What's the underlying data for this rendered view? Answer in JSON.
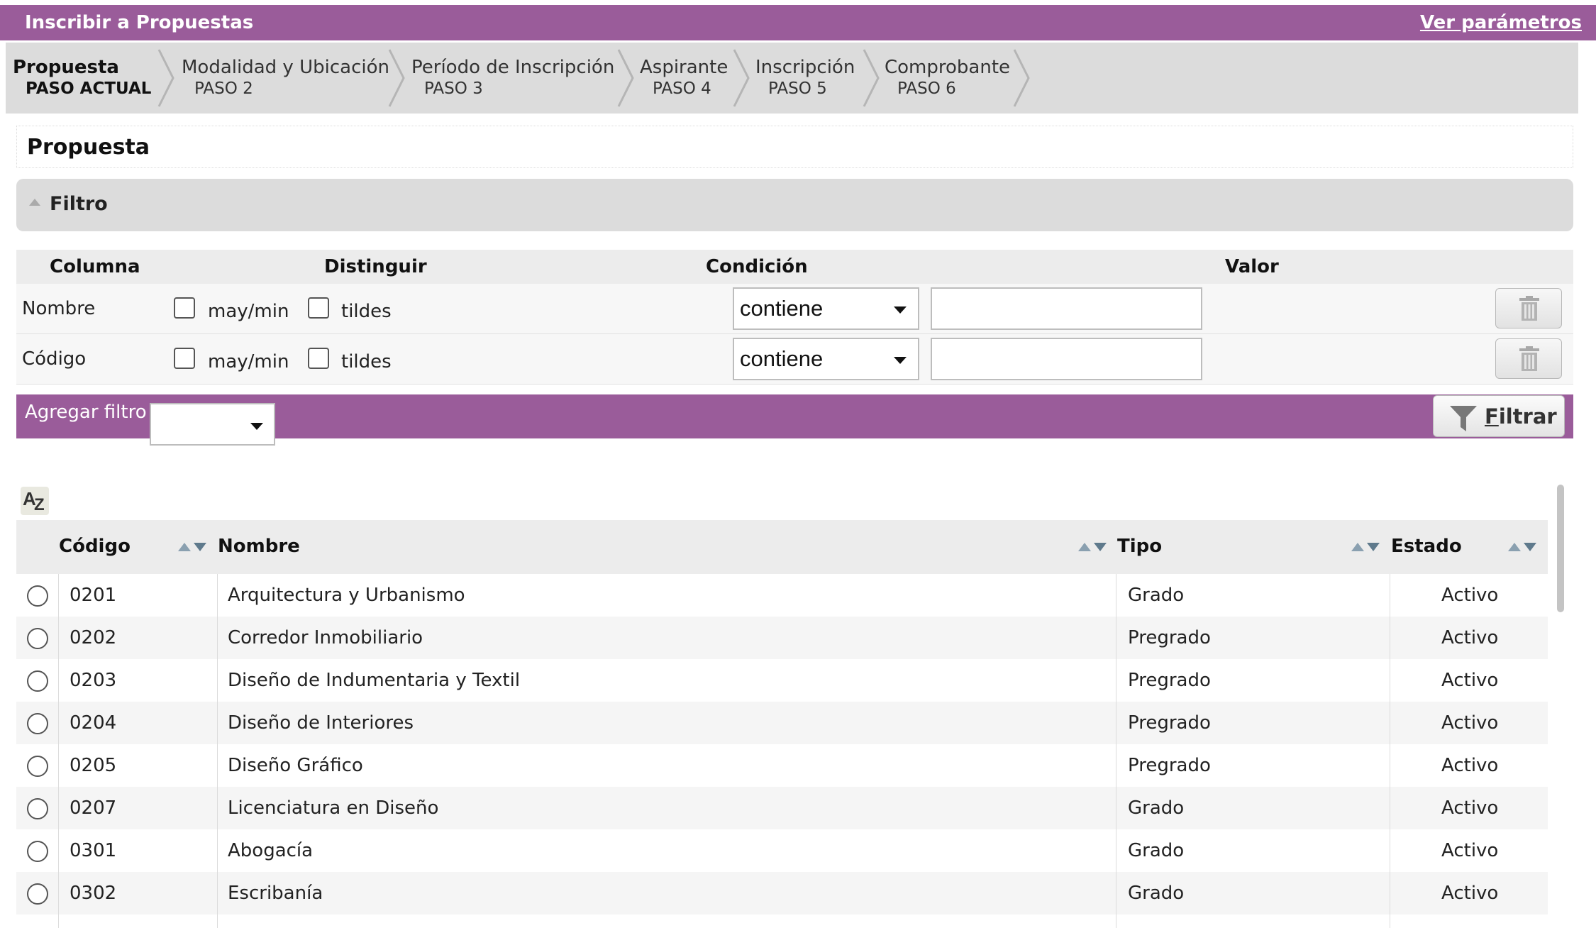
{
  "titlebar": {
    "title": "Inscribir a Propuestas",
    "params_link": "Ver parámetros"
  },
  "steps": [
    {
      "label": "Propuesta",
      "sub": "PASO ACTUAL",
      "current": true
    },
    {
      "label": "Modalidad y Ubicación",
      "sub": "PASO 2"
    },
    {
      "label": "Período de Inscripción",
      "sub": "PASO 3"
    },
    {
      "label": "Aspirante",
      "sub": "PASO 4"
    },
    {
      "label": "Inscripción",
      "sub": "PASO 5"
    },
    {
      "label": "Comprobante",
      "sub": "PASO 6"
    }
  ],
  "section": {
    "title": "Propuesta"
  },
  "filtro": {
    "label": "Filtro",
    "headers": {
      "columna": "Columna",
      "distinguir": "Distinguir",
      "condicion": "Condición",
      "valor": "Valor"
    },
    "rows": [
      {
        "column": "Nombre",
        "case_label": "may/min",
        "accent_label": "tildes",
        "condition": "contiene",
        "value": ""
      },
      {
        "column": "Código",
        "case_label": "may/min",
        "accent_label": "tildes",
        "condition": "contiene",
        "value": ""
      }
    ],
    "add_filter_label": "Agregar filtro",
    "add_filter_value": "",
    "filter_button_first": "F",
    "filter_button_rest": "iltrar"
  },
  "results": {
    "headers": {
      "codigo": "Código",
      "nombre": "Nombre",
      "tipo": "Tipo",
      "estado": "Estado"
    },
    "rows": [
      {
        "codigo": "0201",
        "nombre": "Arquitectura y Urbanismo",
        "tipo": "Grado",
        "estado": "Activo"
      },
      {
        "codigo": "0202",
        "nombre": "Corredor Inmobiliario",
        "tipo": "Pregrado",
        "estado": "Activo"
      },
      {
        "codigo": "0203",
        "nombre": "Diseño de Indumentaria y Textil",
        "tipo": "Pregrado",
        "estado": "Activo"
      },
      {
        "codigo": "0204",
        "nombre": "Diseño de Interiores",
        "tipo": "Pregrado",
        "estado": "Activo"
      },
      {
        "codigo": "0205",
        "nombre": "Diseño Gráfico",
        "tipo": "Pregrado",
        "estado": "Activo"
      },
      {
        "codigo": "0207",
        "nombre": "Licenciatura en Diseño",
        "tipo": "Grado",
        "estado": "Activo"
      },
      {
        "codigo": "0301",
        "nombre": "Abogacía",
        "tipo": "Grado",
        "estado": "Activo"
      },
      {
        "codigo": "0302",
        "nombre": "Escribanía",
        "tipo": "Grado",
        "estado": "Activo"
      }
    ]
  },
  "colors": {
    "brand": "#9a5c9a",
    "panel_gray": "#dcdcdc",
    "row_alt": "#f5f5f5"
  },
  "icons": {
    "sort": "sort-arrows-icon",
    "trash": "trash-icon",
    "funnel": "funnel-icon",
    "az": "az-sort-icon"
  }
}
